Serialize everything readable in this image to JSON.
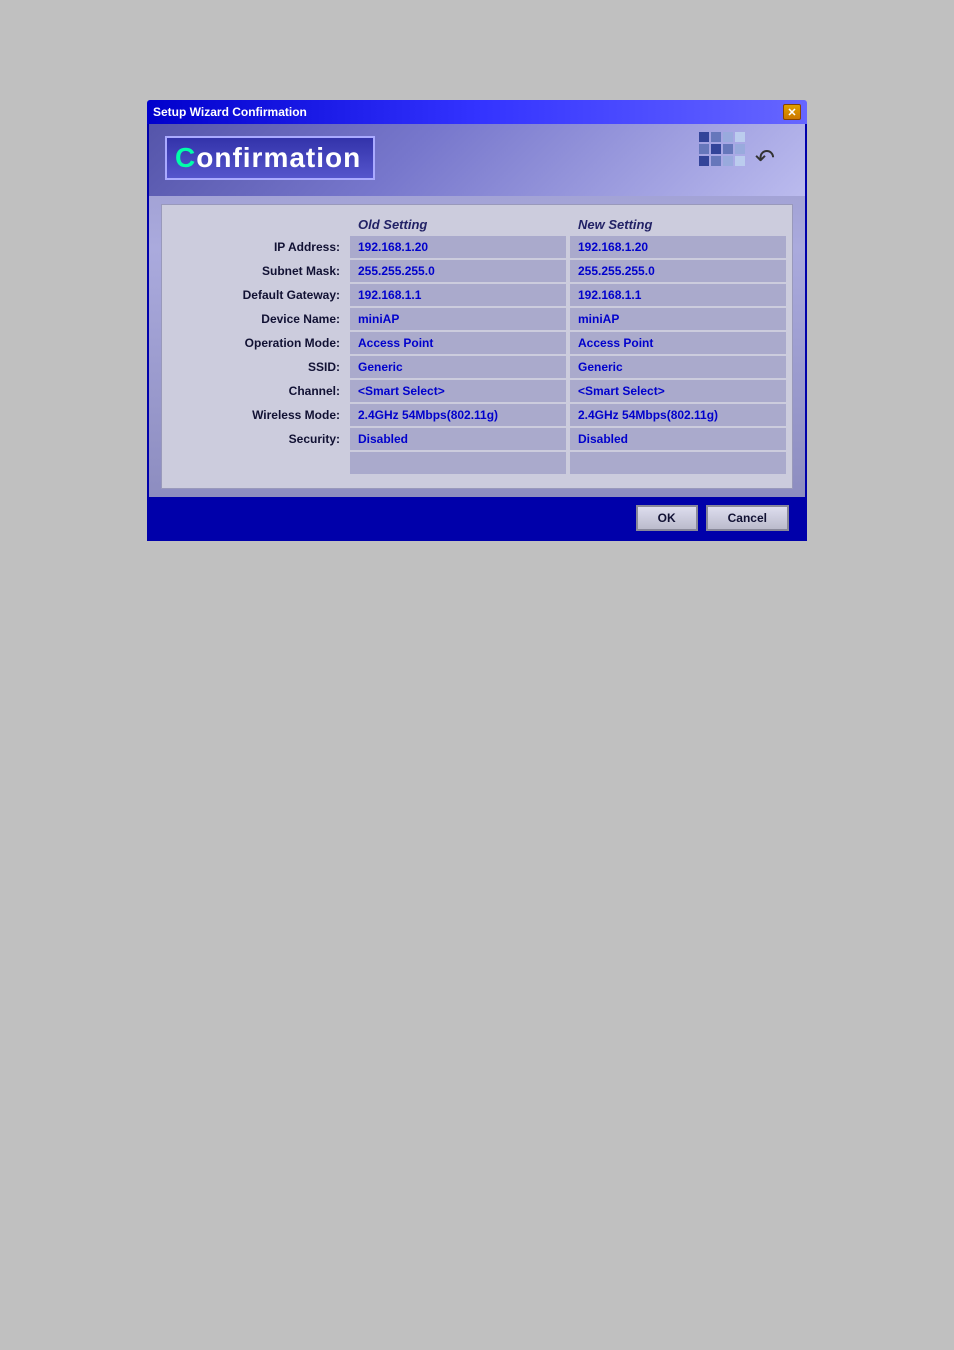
{
  "titleBar": {
    "label": "Setup Wizard Confirmation",
    "closeLabel": "✕"
  },
  "header": {
    "title": "onfirmation",
    "firstLetter": "C"
  },
  "columns": {
    "oldSetting": "Old Setting",
    "newSetting": "New Setting"
  },
  "rows": [
    {
      "label": "IP Address:",
      "oldValue": "192.168.1.20",
      "newValue": "192.168.1.20"
    },
    {
      "label": "Subnet Mask:",
      "oldValue": "255.255.255.0",
      "newValue": "255.255.255.0"
    },
    {
      "label": "Default Gateway:",
      "oldValue": "192.168.1.1",
      "newValue": "192.168.1.1"
    },
    {
      "label": "Device Name:",
      "oldValue": "miniAP",
      "newValue": "miniAP"
    },
    {
      "label": "Operation Mode:",
      "oldValue": "Access Point",
      "newValue": "Access Point"
    },
    {
      "label": "SSID:",
      "oldValue": "Generic",
      "newValue": "Generic"
    },
    {
      "label": "Channel:",
      "oldValue": "<Smart Select>",
      "newValue": "<Smart Select>"
    },
    {
      "label": "Wireless Mode:",
      "oldValue": "2.4GHz 54Mbps(802.11g)",
      "newValue": "2.4GHz 54Mbps(802.11g)"
    },
    {
      "label": "Security:",
      "oldValue": "Disabled",
      "newValue": "Disabled"
    },
    {
      "label": "",
      "oldValue": "",
      "newValue": ""
    }
  ],
  "footer": {
    "okLabel": "OK",
    "cancelLabel": "Cancel"
  }
}
